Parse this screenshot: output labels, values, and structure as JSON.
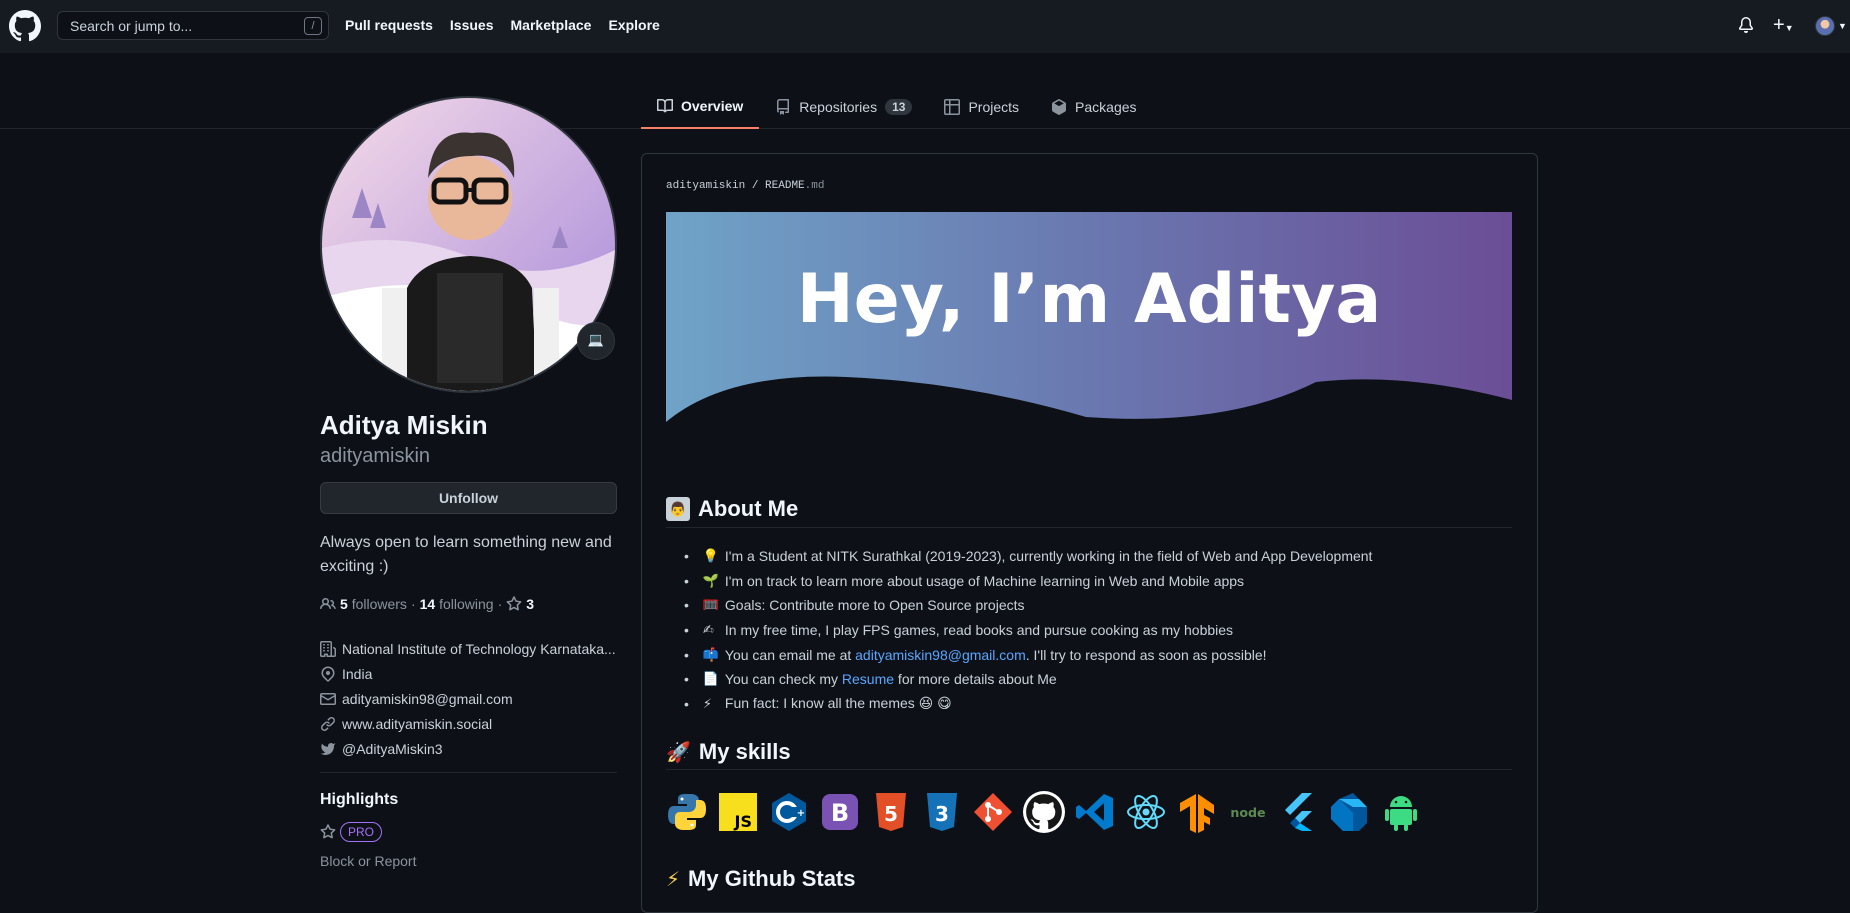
{
  "header": {
    "search_placeholder": "Search or jump to...",
    "search_shortcut": "/",
    "nav": [
      "Pull requests",
      "Issues",
      "Marketplace",
      "Explore"
    ]
  },
  "tabs": [
    {
      "label": "Overview",
      "icon": "book-icon"
    },
    {
      "label": "Repositories",
      "count": "13",
      "icon": "repo-icon"
    },
    {
      "label": "Projects",
      "icon": "project-icon"
    },
    {
      "label": "Packages",
      "icon": "package-icon"
    }
  ],
  "profile": {
    "name": "Aditya Miskin",
    "username": "adityamiskin",
    "status_emoji": "💻",
    "unfollow_label": "Unfollow",
    "bio": "Always open to learn something new and exciting :)",
    "followers_count": "5",
    "followers_label": "followers",
    "following_count": "14",
    "following_label": "following",
    "stars_count": "3",
    "organization": "National Institute of Technology Karnataka...",
    "location": "India",
    "email": "adityamiskin98@gmail.com",
    "website": "www.adityamiskin.social",
    "twitter": "@AdityaMiskin3",
    "highlights_heading": "Highlights",
    "pro_badge": "PRO",
    "block_report": "Block or Report"
  },
  "readme": {
    "owner": "adityamiskin",
    "separator": "/",
    "file": "README",
    "ext": ".md",
    "banner_text": "Hey, I’m Aditya",
    "about_heading": "About Me",
    "about_items": [
      {
        "emoji": "💡",
        "text": "I'm a Student at NITK Surathkal (2019-2023), currently working in the field of Web and App Development"
      },
      {
        "emoji": "🌱",
        "text": "I'm on track to learn more about usage of Machine learning in Web and Mobile apps"
      },
      {
        "emoji": "🥅",
        "text": "Goals: Contribute more to Open Source projects"
      },
      {
        "emoji": "✍",
        "text": "In my free time, I play FPS games, read books and pursue cooking as my hobbies"
      },
      {
        "emoji": "📫",
        "text_before": "You can email me at ",
        "link": "adityamiskin98@gmail.com",
        "text_after": ". I'll try to respond as soon as possible!"
      },
      {
        "emoji": "📄",
        "text_before": "You can check my ",
        "link": "Resume",
        "text_after": " for more details about Me"
      },
      {
        "emoji": "⚡",
        "text": "Fun fact: I know all the memes 😆 😋"
      }
    ],
    "skills_heading": "My skills",
    "skills": [
      "python-icon",
      "javascript-icon",
      "cplusplus-icon",
      "bootstrap-icon",
      "html5-icon",
      "css3-icon",
      "git-icon",
      "github-icon",
      "vscode-icon",
      "react-icon",
      "tensorflow-icon",
      "nodejs-icon",
      "flutter-icon",
      "dart-icon",
      "android-icon"
    ],
    "stats_heading": "My Github Stats"
  },
  "colors": {
    "bg": "#0d1117",
    "header_bg": "#161b22",
    "accent": "#f78166",
    "link": "#58a6ff",
    "pro": "#a371f7"
  }
}
